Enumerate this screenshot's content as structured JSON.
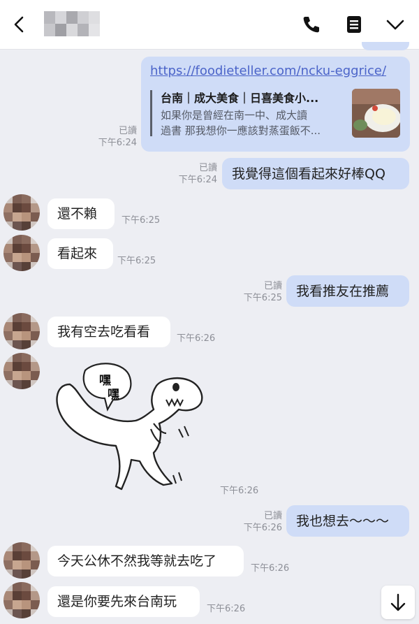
{
  "header": {
    "back_icon": "chevron-left-icon",
    "call_icon": "phone-icon",
    "notes_icon": "notes-icon",
    "menu_icon": "chevron-down-icon"
  },
  "link_card": {
    "url": "https://foodieteller.com/ncku-eggrice/",
    "title": "台南｜成大美食｜日喜美食小...",
    "desc_line1": "如果你是曾經在南一中、成大讀",
    "desc_line2": "過書 那我想你一應該對蒸蛋飯不...",
    "read": "已讀",
    "time": "下午6:24"
  },
  "messages": [
    {
      "side": "out",
      "text": "我覺得這個看起來好棒QQ",
      "read": "已讀",
      "time": "下午6:24"
    },
    {
      "side": "in",
      "text": "還不賴",
      "time": "下午6:25"
    },
    {
      "side": "in",
      "text": "看起來",
      "time": "下午6:25"
    },
    {
      "side": "out",
      "text": "我看推友在推薦",
      "read": "已讀",
      "time": "下午6:25"
    },
    {
      "side": "in",
      "text": "我有空去吃看看",
      "time": "下午6:26"
    },
    {
      "side": "in",
      "sticker_text": "嘿嘿",
      "time": "下午6:26"
    },
    {
      "side": "out",
      "text": "我也想去～～～",
      "read": "已讀",
      "time": "下午6:26"
    },
    {
      "side": "in",
      "text": "今天公休不然我等就去吃了",
      "time": "下午6:26"
    },
    {
      "side": "in",
      "text": "還是你要先來台南玩",
      "time": "下午6:26"
    }
  ],
  "scroll_button_icon": "arrow-down-icon",
  "colors": {
    "background": "#edeef3",
    "incoming_bubble": "#ffffff",
    "outgoing_bubble": "#cfdcf7",
    "link": "#4b64c9"
  }
}
